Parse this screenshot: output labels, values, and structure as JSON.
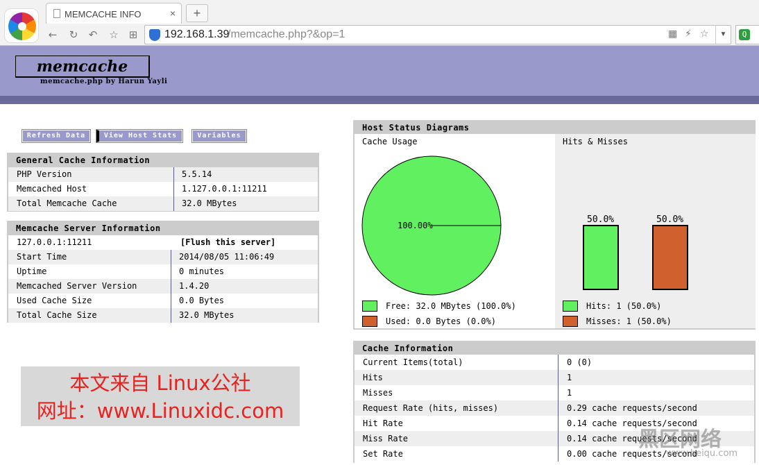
{
  "browser": {
    "tab_title": "MEMCACHE INFO",
    "tab_close": "×",
    "new_tab": "+",
    "url_host": "192.168.1.39",
    "url_path": "/memcache.php?&op=1",
    "search_badge": "Q"
  },
  "header": {
    "title": "memcache",
    "subtitle": "memcache.php by Harun Yayli"
  },
  "menu": {
    "refresh": "Refresh Data",
    "host_stats": "View Host Stats",
    "variables": "Variables"
  },
  "general_cache": {
    "title": "General Cache Information",
    "rows": [
      {
        "k": "PHP Version",
        "v": "5.5.14"
      },
      {
        "k": "Memcached Host",
        "v": "1.127.0.0.1:11211"
      },
      {
        "k": "Total Memcache Cache",
        "v": "32.0 MBytes"
      }
    ]
  },
  "server_info": {
    "title": "Memcache Server Information",
    "server": "127.0.0.1:11211",
    "flush": "[Flush this server]",
    "rows": [
      {
        "k": "Start Time",
        "v": "2014/08/05 11:06:49"
      },
      {
        "k": "Uptime",
        "v": "0 minutes"
      },
      {
        "k": "Memcached Server Version",
        "v": "1.4.20"
      },
      {
        "k": "Used Cache Size",
        "v": "0.0 Bytes"
      },
      {
        "k": "Total Cache Size",
        "v": "32.0 MBytes"
      }
    ]
  },
  "diagrams": {
    "title": "Host Status Diagrams",
    "cache_usage_label": "Cache Usage",
    "hits_misses_label": "Hits & Misses",
    "pie_label": "100.00%",
    "legend_free": "Free: 32.0 MBytes (100.0%)",
    "legend_used": "Used: 0.0 Bytes (0.0%)",
    "legend_hits": "Hits: 1 (50.0%)",
    "legend_misses": "Misses: 1 (50.0%)",
    "colors": {
      "green": "#60f060",
      "orange": "#d0602e"
    }
  },
  "chart_data": [
    {
      "type": "pie",
      "categories": [
        "Free",
        "Used"
      ],
      "values": [
        100.0,
        0.0
      ],
      "unit": "%"
    },
    {
      "type": "bar",
      "categories": [
        "Hits",
        "Misses"
      ],
      "values": [
        50.0,
        50.0
      ],
      "unit": "%",
      "ylim": [
        0,
        100
      ]
    }
  ],
  "cache_info": {
    "title": "Cache Information",
    "rows": [
      {
        "k": "Current Items(total)",
        "v": "0 (0)"
      },
      {
        "k": "Hits",
        "v": "1"
      },
      {
        "k": "Misses",
        "v": "1"
      },
      {
        "k": "Request Rate (hits, misses)",
        "v": "0.29 cache requests/second"
      },
      {
        "k": "Hit Rate",
        "v": "0.14 cache requests/second"
      },
      {
        "k": "Miss Rate",
        "v": "0.14 cache requests/second"
      },
      {
        "k": "Set Rate",
        "v": "0.00 cache requests/second"
      }
    ]
  },
  "watermark": {
    "line1": "本文来自 Linux公社",
    "line2": "网址：www.Linuxidc.com",
    "site": "黑区网络",
    "site_url": "www.heiqu.com"
  }
}
